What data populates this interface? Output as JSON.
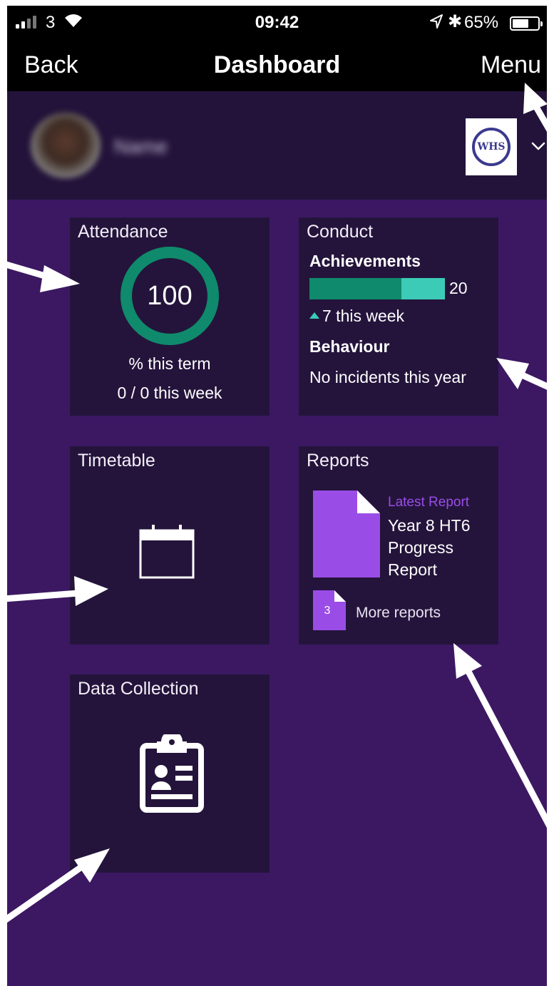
{
  "status_bar": {
    "carrier": "3",
    "time": "09:42",
    "battery_percent": "65%",
    "battery_level": 0.65,
    "signal_bars_on": 2,
    "signal_bars_total": 4
  },
  "nav": {
    "back_label": "Back",
    "title": "Dashboard",
    "menu_label": "Menu"
  },
  "profile": {
    "name": "Name",
    "school_logo_text": "WHS"
  },
  "attendance": {
    "title": "Attendance",
    "value": "100",
    "percent_fill": 1.0,
    "percent_label": "% this term",
    "week_label": "0 / 0 this week",
    "ring_color": "#0f8a6c"
  },
  "conduct": {
    "title": "Conduct",
    "achievements_heading": "Achievements",
    "achievements_value": "20",
    "bar_dark_fraction": 0.68,
    "week_label": "7 this week",
    "behaviour_heading": "Behaviour",
    "behaviour_text": "No incidents this year"
  },
  "timetable": {
    "title": "Timetable",
    "icon": "calendar-icon"
  },
  "reports": {
    "title": "Reports",
    "latest_label": "Latest Report",
    "latest_title": "Year 8 HT6 Progress Report",
    "more_count": "3",
    "more_label": "More reports",
    "accent_color": "#9a4de6"
  },
  "data_collection": {
    "title": "Data Collection",
    "icon": "clipboard-icon"
  },
  "colors": {
    "background": "#3c1862",
    "tile": "#24143b",
    "teal": "#3ccbb7",
    "green": "#0f8a6c"
  }
}
